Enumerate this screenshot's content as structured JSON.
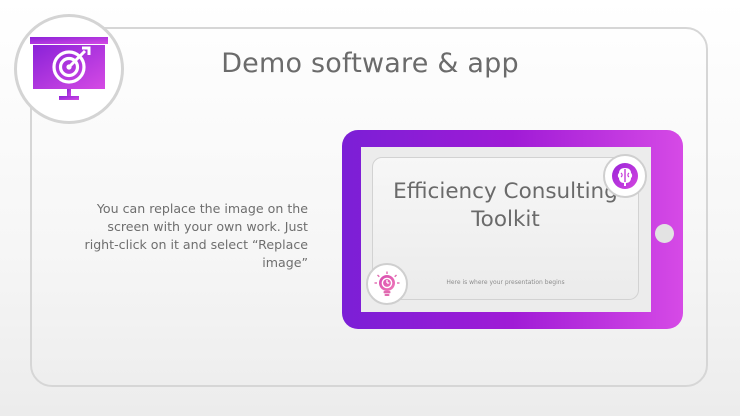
{
  "slide": {
    "title": "Demo software & app",
    "body": "You can replace the image on the screen with your own work. Just right-click on it and select “Replace image”",
    "icon": "target-presentation-icon"
  },
  "device": {
    "screen_title": "Efficiency Consulting Toolkit",
    "screen_subtitle": "Here is where your presentation begins",
    "badge_top_icon": "brain-icon",
    "badge_bottom_icon": "lightbulb-clock-icon"
  },
  "colors": {
    "accent_start": "#7b1fd6",
    "accent_end": "#d64ae6",
    "text": "#6b6b6b",
    "frame_border": "#d6d6d6"
  }
}
